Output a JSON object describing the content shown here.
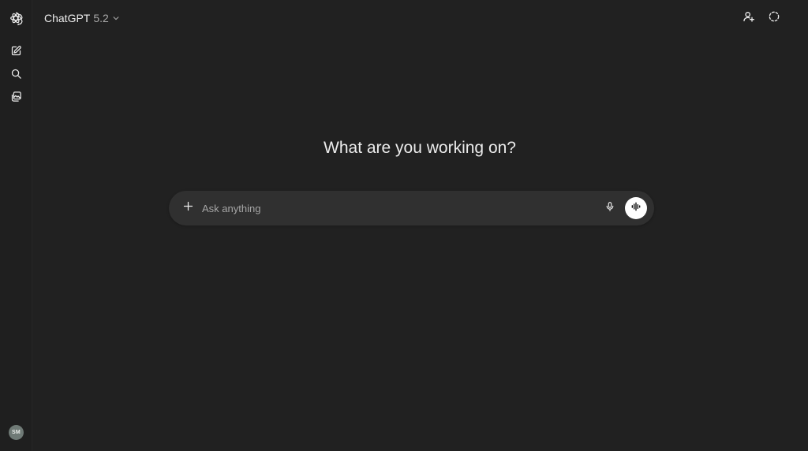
{
  "header": {
    "model_name": "ChatGPT",
    "model_version": "5.2"
  },
  "sidebar": {
    "items": [
      {
        "icon": "new-chat-icon"
      },
      {
        "icon": "search-icon"
      },
      {
        "icon": "library-icon"
      }
    ],
    "user_initials": "SM"
  },
  "main": {
    "headline": "What are you working on?"
  },
  "composer": {
    "placeholder": "Ask anything"
  },
  "colors": {
    "background": "#212121",
    "sidebar": "#1f1f1f",
    "composer": "#303030",
    "text": "#ececec",
    "avatar": "#6f7a76"
  }
}
